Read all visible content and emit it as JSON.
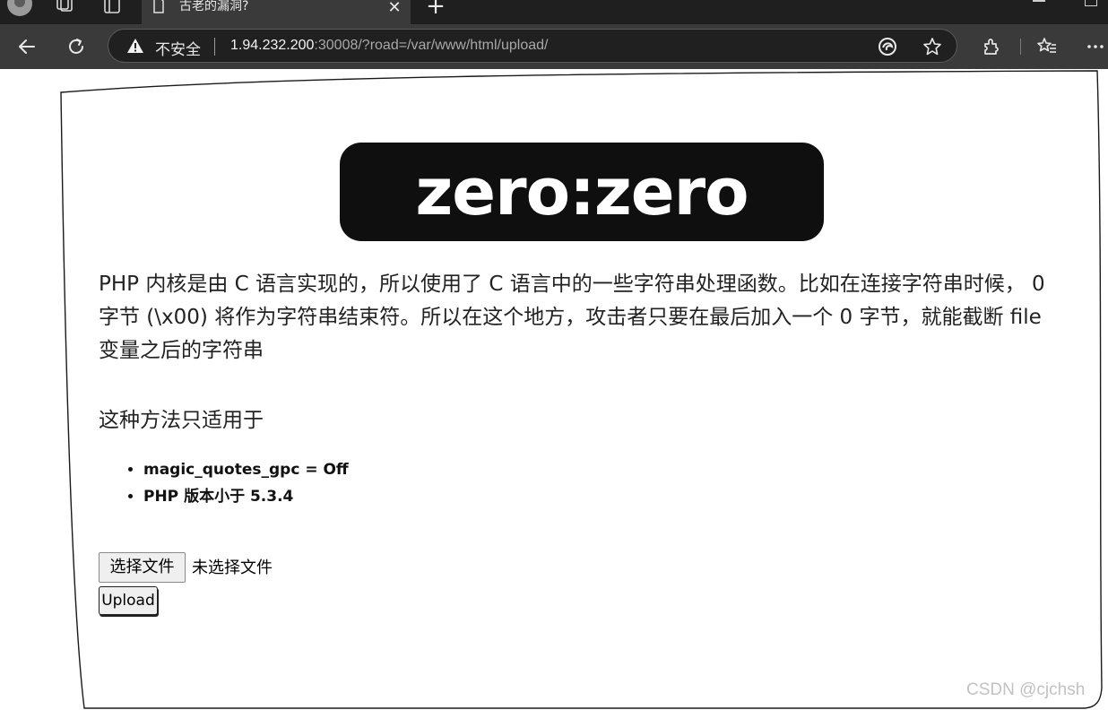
{
  "browser": {
    "tab": {
      "title": "古老的漏洞?"
    },
    "address_bar": {
      "security_label": "不安全",
      "url_host": "1.94.232.200",
      "url_rest": ":30008/?road=/var/www/html/upload/"
    }
  },
  "page": {
    "logo_text": "zero:zero",
    "paragraph": "PHP 内核是由 C 语言实现的，所以使用了 C 语言中的一些字符串处理函数。比如在连接字符串时候， 0 字节 (\\x00) 将作为字符串结束符。所以在这个地方，攻击者只要在最后加入一个 0 字节，就能截断 file 变量之后的字符串",
    "subheading": "这种方法只适用于",
    "conditions": [
      "magic_quotes_gpc = Off",
      "PHP 版本小于 5.3.4"
    ],
    "file_input": {
      "button_label": "选择文件",
      "status": "未选择文件"
    },
    "upload_button": "Upload"
  },
  "watermark": "CSDN @cjchsh",
  "colors": {
    "tabbar": "#1f1f1f",
    "toolbar": "#3a3a3a",
    "address_bg": "#202020",
    "logo_bg": "#0f0f0f"
  }
}
